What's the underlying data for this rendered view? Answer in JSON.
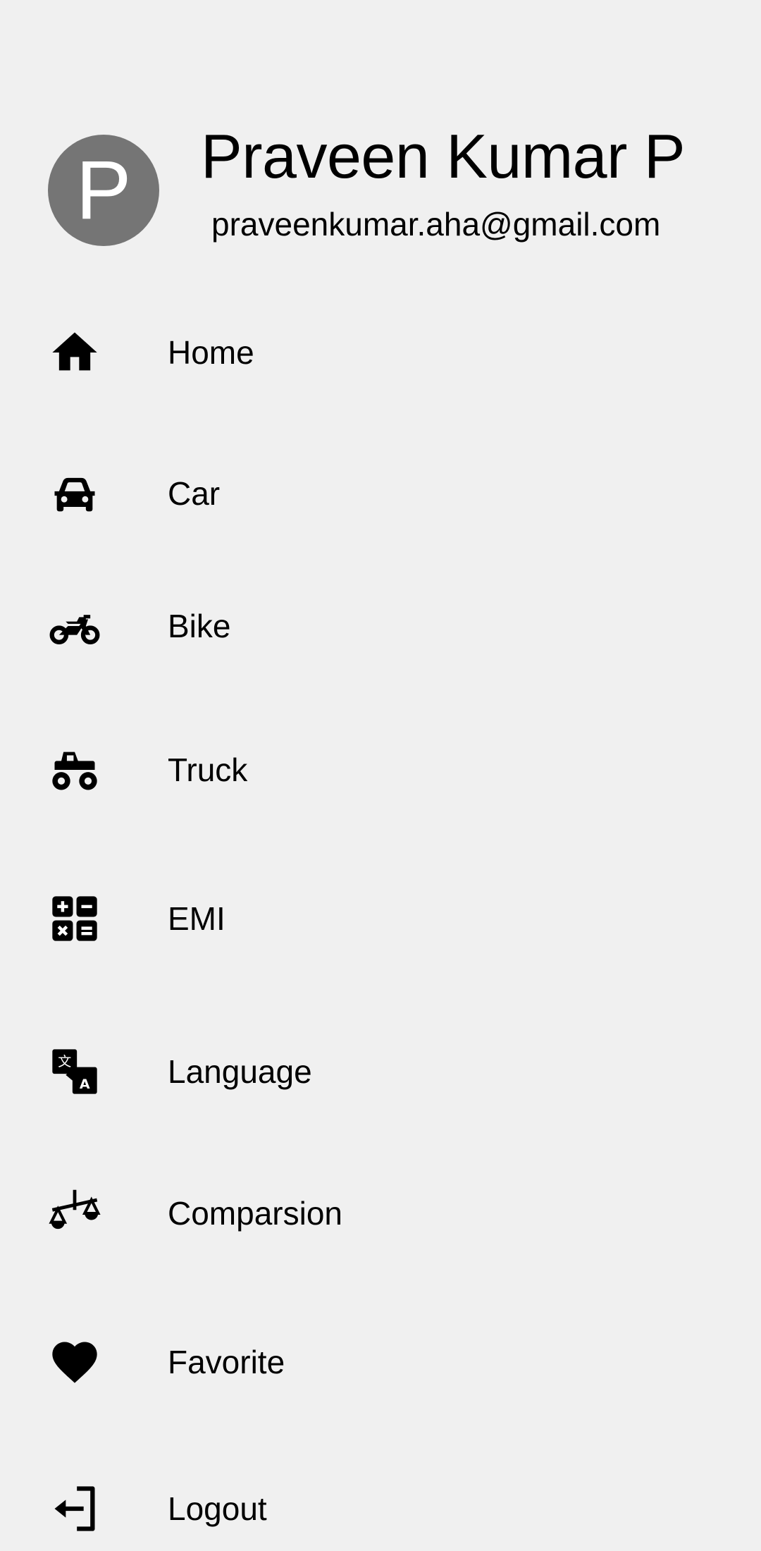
{
  "drawer": {
    "user": {
      "avatar_letter": "P",
      "name": "Praveen Kumar P",
      "email": "praveenkumar.aha@gmail.com"
    },
    "items": [
      {
        "label": "Home",
        "icon": "home-icon"
      },
      {
        "label": "Car",
        "icon": "car-icon"
      },
      {
        "label": "Bike",
        "icon": "motorcycle-icon"
      },
      {
        "label": "Truck",
        "icon": "monster-truck-icon"
      },
      {
        "label": "EMI",
        "icon": "calculator-icon"
      },
      {
        "label": "Language",
        "icon": "translate-icon"
      },
      {
        "label": "Comparsion",
        "icon": "scale-balance-icon"
      },
      {
        "label": "Favorite",
        "icon": "heart-icon"
      },
      {
        "label": "Logout",
        "icon": "logout-icon"
      }
    ]
  },
  "colors": {
    "background": "#f0f0f0",
    "avatar_background": "#757575",
    "avatar_text": "#ffffff",
    "text": "#000000"
  }
}
